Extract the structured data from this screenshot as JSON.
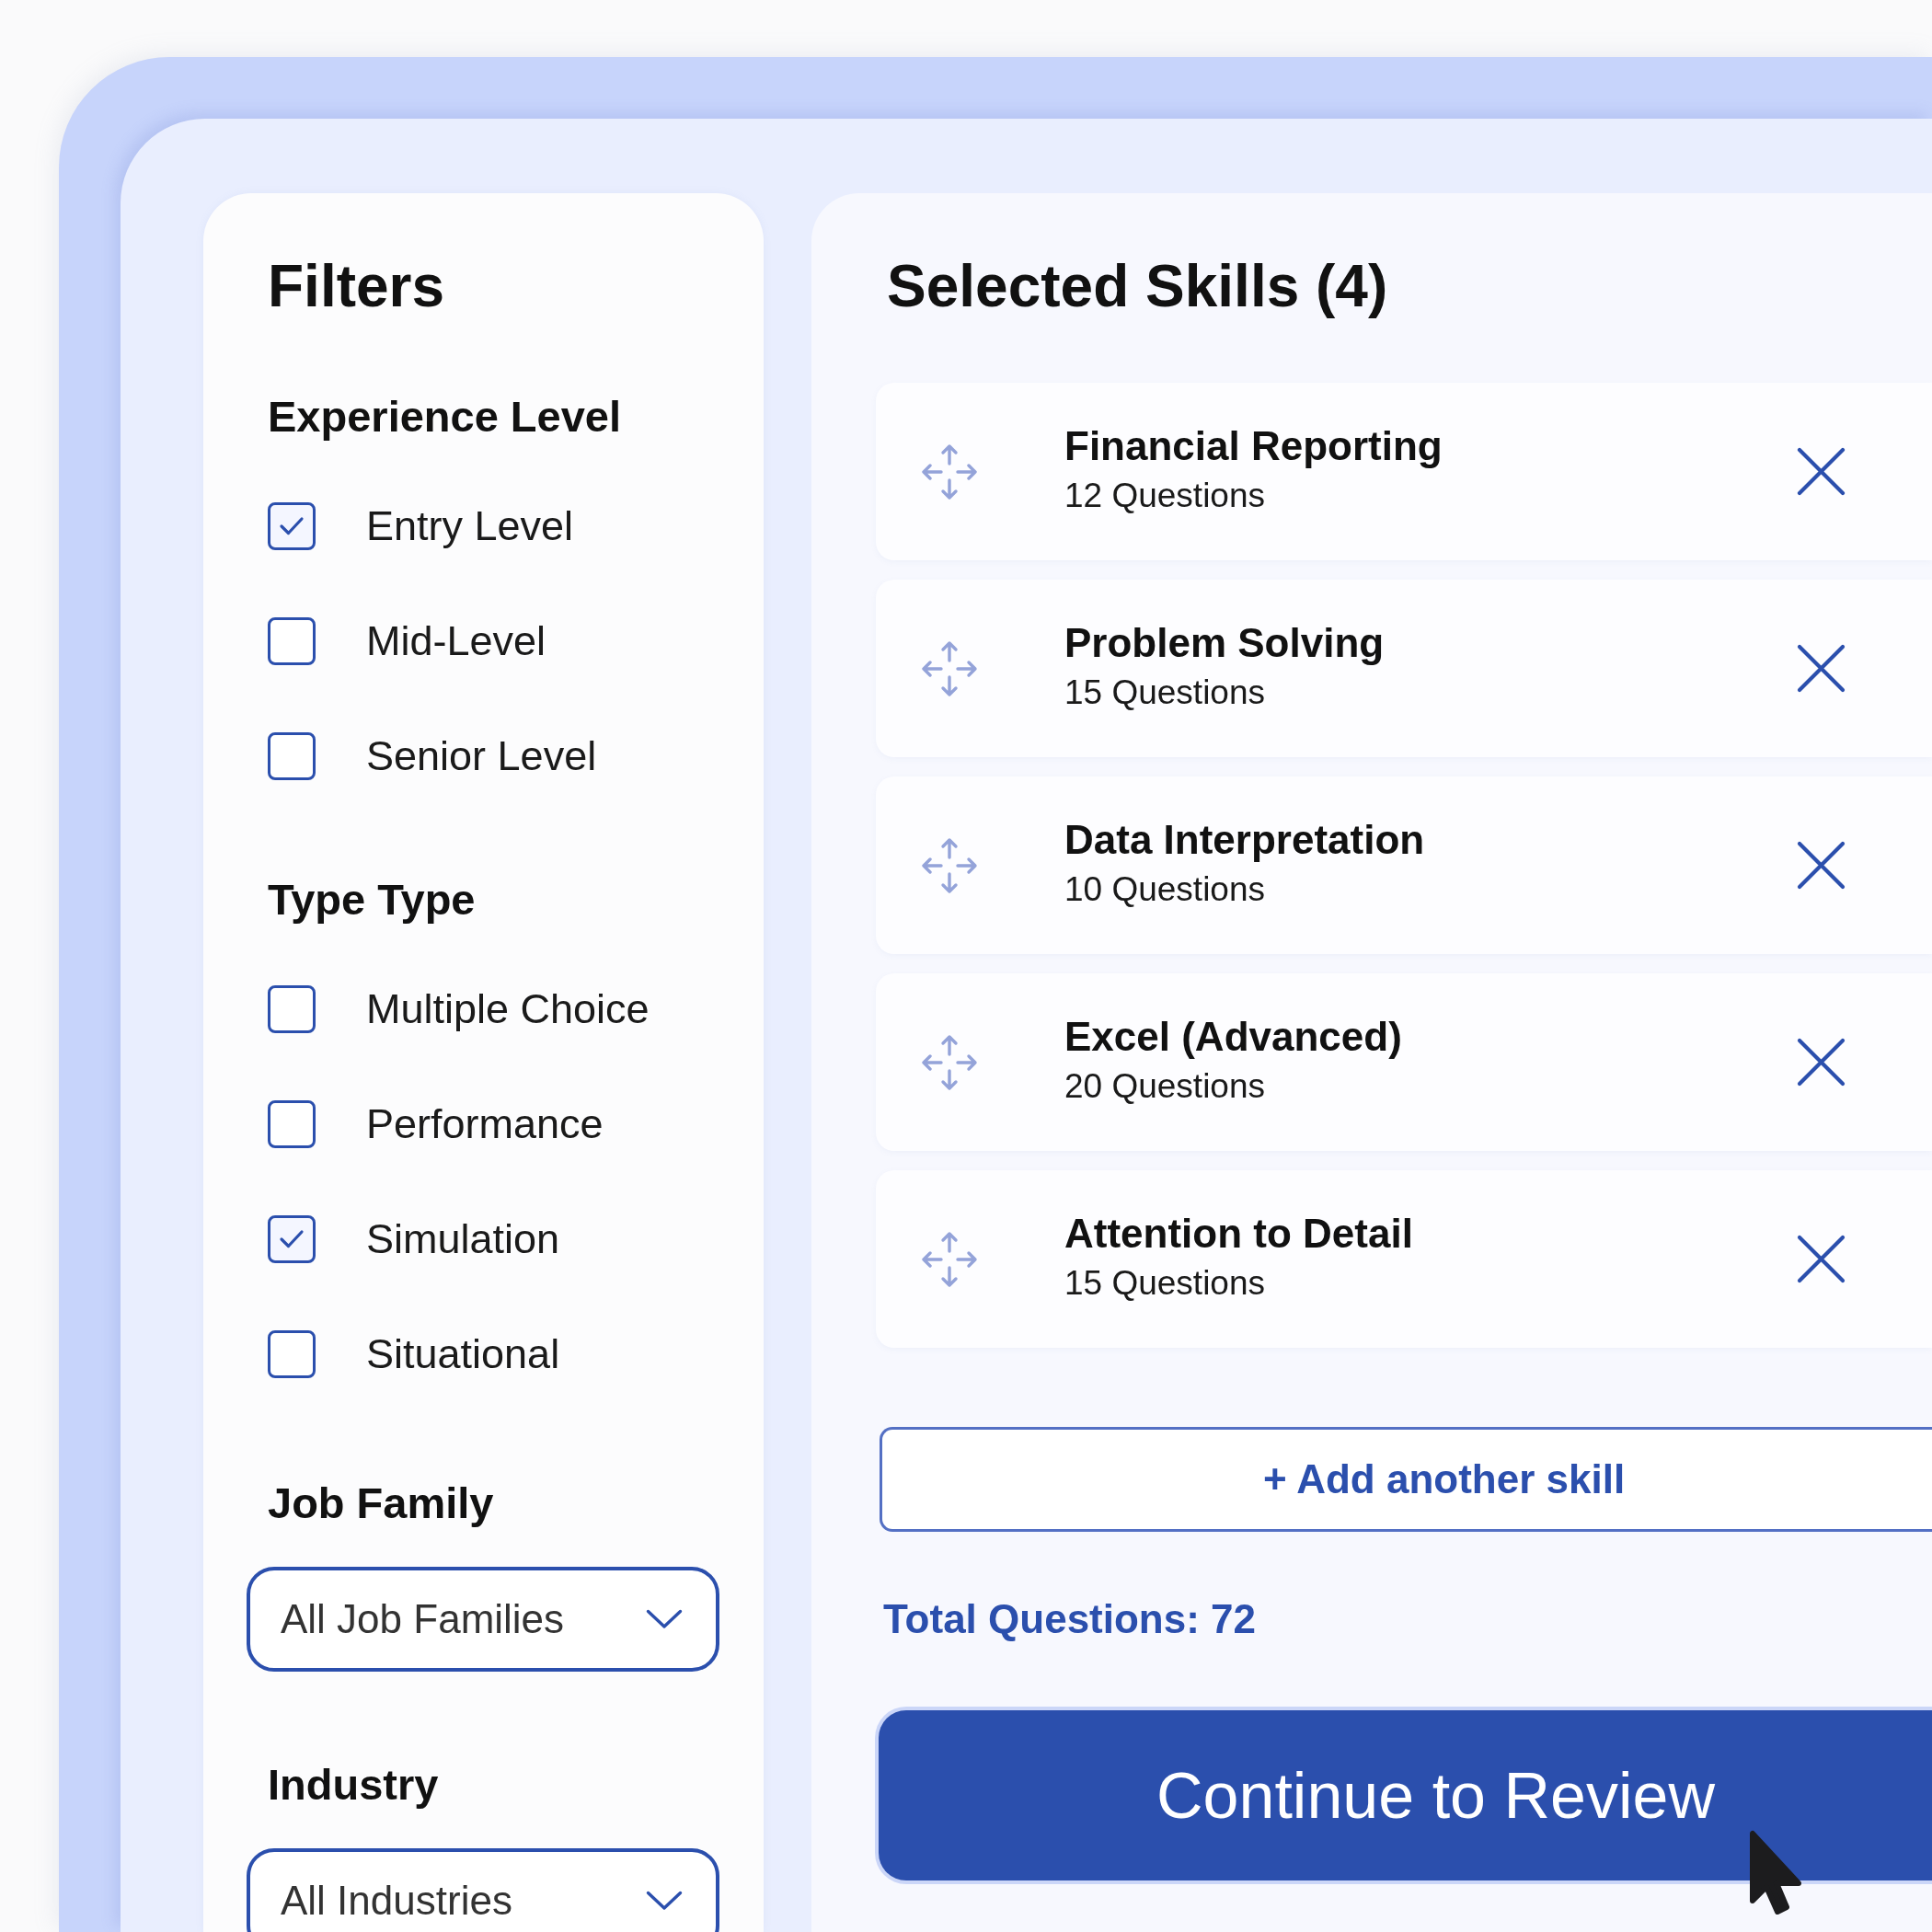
{
  "filters": {
    "title": "Filters",
    "sections": [
      {
        "kind": "checkboxes",
        "title": "Experience Level",
        "options": [
          {
            "label": "Entry Level",
            "checked": true
          },
          {
            "label": "Mid-Level",
            "checked": false
          },
          {
            "label": "Senior Level",
            "checked": false
          }
        ]
      },
      {
        "kind": "checkboxes",
        "title": "Type Type",
        "options": [
          {
            "label": "Multiple Choice",
            "checked": false
          },
          {
            "label": "Performance",
            "checked": false
          },
          {
            "label": "Simulation",
            "checked": true
          },
          {
            "label": "Situational",
            "checked": false
          }
        ]
      },
      {
        "kind": "dropdown",
        "title": "Job Family",
        "value": "All Job Families"
      },
      {
        "kind": "dropdown",
        "title": "Industry",
        "value": "All Industries"
      }
    ]
  },
  "skills_panel": {
    "title": "Selected Skills (4)",
    "skills": [
      {
        "name": "Financial Reporting",
        "questions": "12 Questions"
      },
      {
        "name": "Problem Solving",
        "questions": "15 Questions"
      },
      {
        "name": "Data Interpretation",
        "questions": "10 Questions"
      },
      {
        "name": "Excel (Advanced)",
        "questions": "20 Questions"
      },
      {
        "name": "Attention to Detail",
        "questions": "15 Questions"
      }
    ],
    "add_button": "+ Add another skill",
    "total": "Total Questions: 72",
    "continue_button": "Continue to Review"
  }
}
